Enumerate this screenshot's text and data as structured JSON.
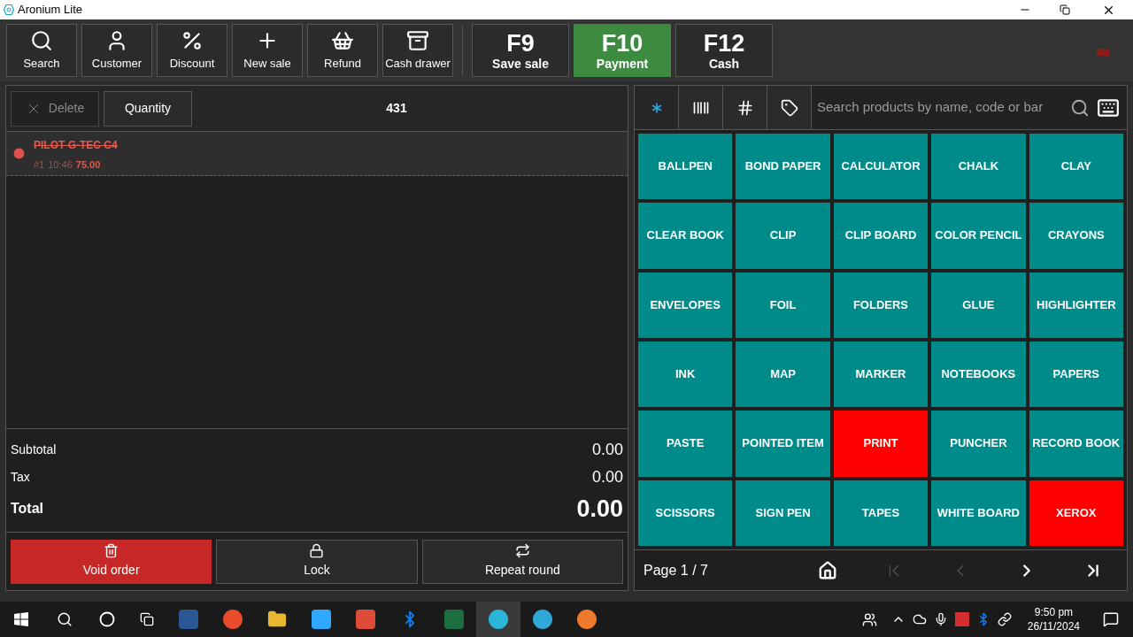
{
  "window": {
    "title": "Aronium Lite"
  },
  "toolbar": [
    {
      "kind": "search",
      "label": "Search"
    },
    {
      "kind": "customer",
      "label": "Customer"
    },
    {
      "kind": "discount",
      "label": "Discount"
    },
    {
      "kind": "new",
      "label": "New sale"
    },
    {
      "kind": "refund",
      "label": "Refund"
    },
    {
      "kind": "drawer",
      "label": "Cash drawer"
    }
  ],
  "function_keys": [
    {
      "key": "F9",
      "label": "Save sale",
      "highlighted": false
    },
    {
      "key": "F10",
      "label": "Payment",
      "highlighted": true
    },
    {
      "key": "F12",
      "label": "Cash",
      "highlighted": false
    }
  ],
  "order": {
    "delete_button": {
      "label": "Delete",
      "disabled": true
    },
    "quantity_button": "Quantity",
    "count": "431",
    "items": [
      {
        "name": "PILOT G-TEC C4",
        "number": "#1",
        "time": "10:46",
        "price": "75.00",
        "voided": true
      }
    ],
    "totals": [
      {
        "label": "Subtotal",
        "value": "0.00"
      },
      {
        "label": "Tax",
        "value": "0.00"
      }
    ],
    "total": {
      "label": "Total",
      "value": "0.00"
    },
    "actions": [
      {
        "kind": "void",
        "label": "Void order"
      },
      {
        "kind": "lock",
        "label": "Lock"
      },
      {
        "kind": "repeat",
        "label": "Repeat round"
      }
    ]
  },
  "products": {
    "modes": [
      {
        "kind": "all",
        "selected": true
      },
      {
        "kind": "barcode",
        "selected": false
      },
      {
        "kind": "code",
        "selected": false
      },
      {
        "kind": "tag",
        "selected": false
      }
    ],
    "search_placeholder": "Search products by name, code or bar",
    "tiles": [
      {
        "label": "BALLPEN",
        "color": "#008b8b"
      },
      {
        "label": "BOND PAPER",
        "color": "#008b8b"
      },
      {
        "label": "CALCULATOR",
        "color": "#008b8b"
      },
      {
        "label": "CHALK",
        "color": "#008b8b"
      },
      {
        "label": "CLAY",
        "color": "#008b8b"
      },
      {
        "label": "CLEAR BOOK",
        "color": "#008b8b"
      },
      {
        "label": "CLIP",
        "color": "#008b8b"
      },
      {
        "label": "CLIP BOARD",
        "color": "#008b8b"
      },
      {
        "label": "COLOR PENCIL",
        "color": "#008b8b"
      },
      {
        "label": "CRAYONS",
        "color": "#008b8b"
      },
      {
        "label": "ENVELOPES",
        "color": "#008b8b"
      },
      {
        "label": "FOIL",
        "color": "#008b8b"
      },
      {
        "label": "FOLDERS",
        "color": "#008b8b"
      },
      {
        "label": "GLUE",
        "color": "#008b8b"
      },
      {
        "label": "HIGHLIGHTER",
        "color": "#008b8b"
      },
      {
        "label": "INK",
        "color": "#008b8b"
      },
      {
        "label": "MAP",
        "color": "#008b8b"
      },
      {
        "label": "MARKER",
        "color": "#008b8b"
      },
      {
        "label": "NOTEBOOKS",
        "color": "#008b8b"
      },
      {
        "label": "PAPERS",
        "color": "#008b8b"
      },
      {
        "label": "PASTE",
        "color": "#008b8b"
      },
      {
        "label": "POINTED ITEM",
        "color": "#008b8b"
      },
      {
        "label": "PRINT",
        "color": "#ff0000"
      },
      {
        "label": "PUNCHER",
        "color": "#008b8b"
      },
      {
        "label": "RECORD BOOK",
        "color": "#008b8b"
      },
      {
        "label": "SCISSORS",
        "color": "#008b8b"
      },
      {
        "label": "SIGN PEN",
        "color": "#008b8b"
      },
      {
        "label": "TAPES",
        "color": "#008b8b"
      },
      {
        "label": "WHITE BOARD",
        "color": "#008b8b"
      },
      {
        "label": "XEROX",
        "color": "#ff0000"
      }
    ],
    "page": "Page 1 / 7",
    "nav": [
      {
        "kind": "home",
        "disabled": false
      },
      {
        "kind": "first",
        "disabled": true
      },
      {
        "kind": "prev",
        "disabled": true
      },
      {
        "kind": "next",
        "disabled": false
      },
      {
        "kind": "last",
        "disabled": false
      }
    ]
  },
  "taskbar": {
    "time": "9:50 pm",
    "date": "26/11/2024"
  }
}
